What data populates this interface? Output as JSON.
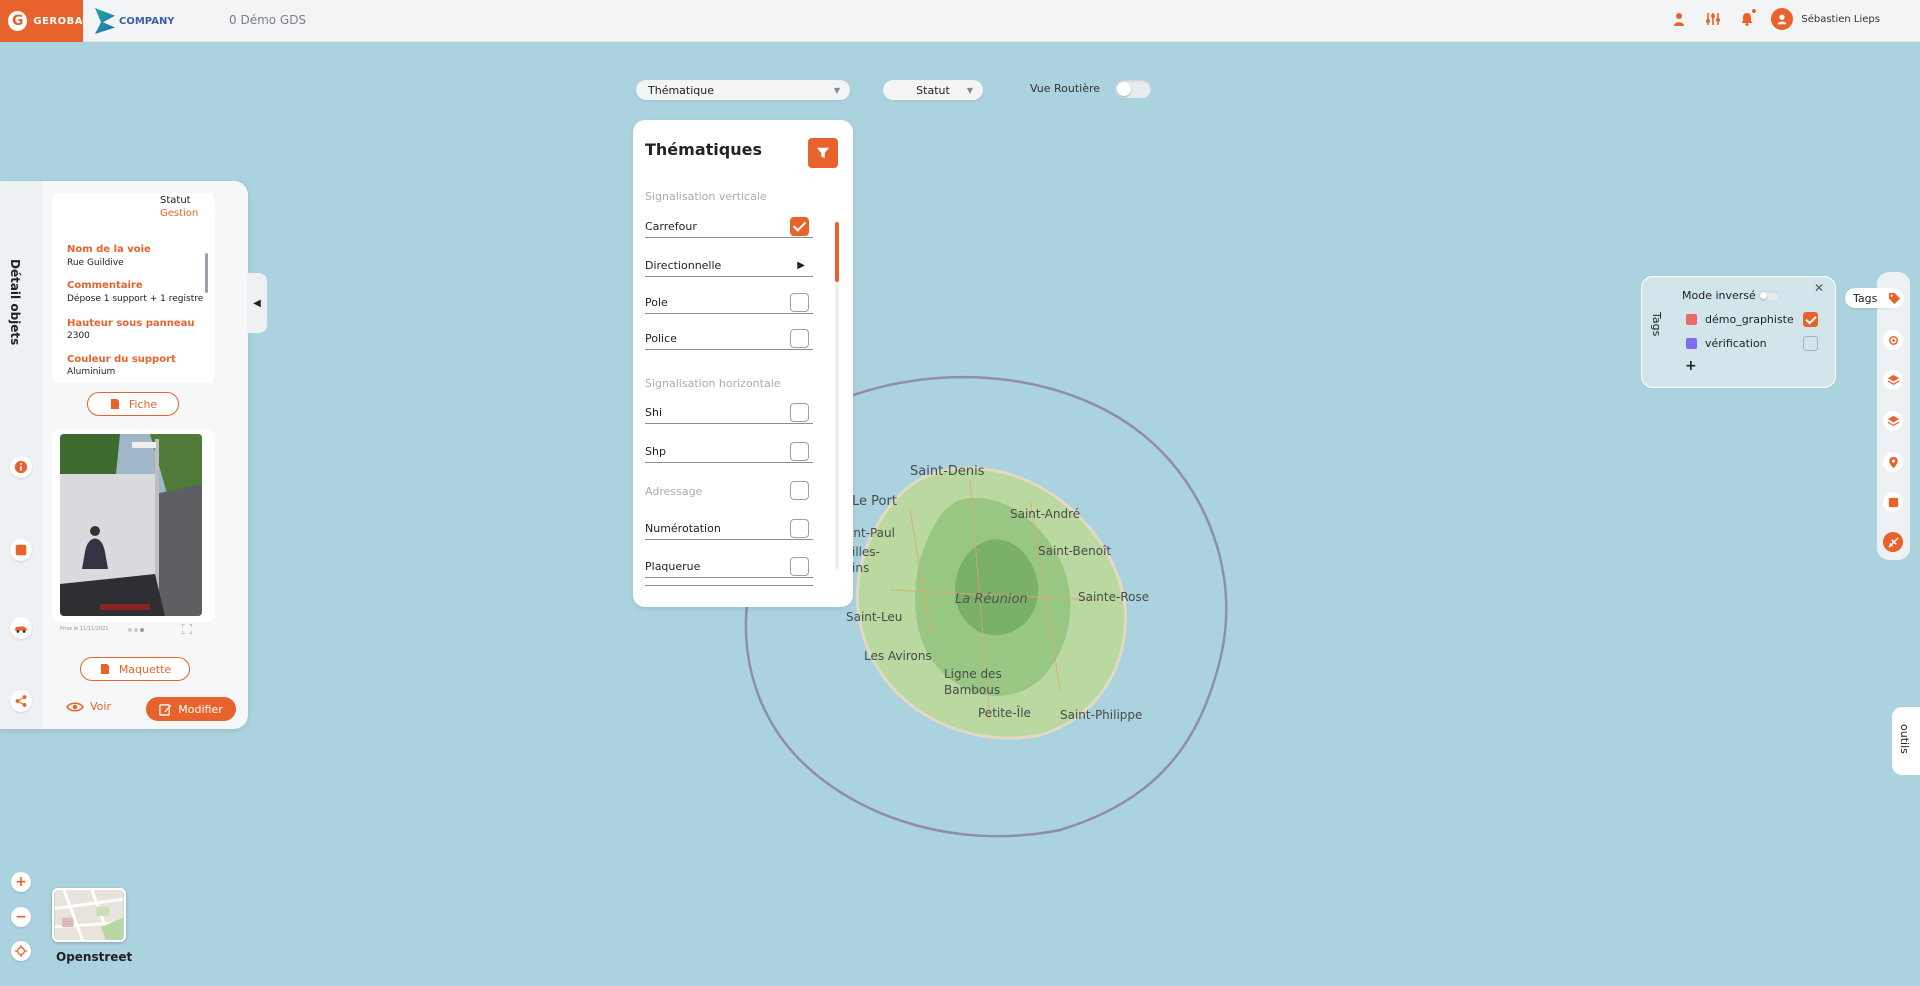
{
  "header": {
    "brand": "GEROBA",
    "company": "COMPANY",
    "project_title": "0 Démo GDS",
    "username": "Sébastien Lieps"
  },
  "controls": {
    "thematique_select": "Thématique",
    "statut_select": "Statut",
    "vue_routiere_label": "Vue Routière",
    "vue_routiere_on": false
  },
  "thematiques": {
    "title": "Thématiques",
    "sections": [
      {
        "label": "Signalisation verticale",
        "items": [
          {
            "label": "Carrefour",
            "checked": true
          },
          {
            "label": "Directionnelle",
            "expandable": true
          },
          {
            "label": "Pole",
            "checked": false
          },
          {
            "label": "Police",
            "checked": false
          }
        ]
      },
      {
        "label": "Signalisation horizontale",
        "items": [
          {
            "label": "Shi",
            "checked": false
          },
          {
            "label": "Shp",
            "checked": false
          }
        ]
      },
      {
        "label": "Adressage",
        "items": [
          {
            "label": "Numérotation",
            "checked": false
          },
          {
            "label": "Plaquerue",
            "checked": false
          }
        ]
      }
    ]
  },
  "detail": {
    "vertical_title": "Détail objets",
    "statut_label": "Statut",
    "statut_value": "Gestion",
    "attributes": [
      {
        "label": "Nom de la voie",
        "value": "Rue Guildive"
      },
      {
        "label": "Commentaire",
        "value": "Dépose 1 support + 1 registre"
      },
      {
        "label": "Hauteur sous panneau",
        "value": "2300"
      },
      {
        "label": "Couleur du support",
        "value": "Aluminium"
      }
    ],
    "fiche_button": "Fiche",
    "maquette_button": "Maquette",
    "voir_button": "Voir",
    "modifier_button": "Modifier",
    "photo_caption": "Prise le 11/11/2021"
  },
  "map": {
    "labels": [
      "Saint-Denis",
      "Le Port",
      "Saint-André",
      "int-Paul",
      "illes-",
      "ins",
      "Saint-Benoît",
      "La Réunion",
      "Sainte-Rose",
      "Saint-Leu",
      "Les Avirons",
      "Ligne des",
      "Bambous",
      "Petite-Île",
      "Saint-Philippe"
    ],
    "basemap_label": "Openstreet"
  },
  "tags_panel": {
    "vertical_title": "Tags",
    "mode_label": "Mode inversé",
    "mode_on": false,
    "tags": [
      {
        "name": "démo_graphiste",
        "color": "#e86a6a",
        "checked": true
      },
      {
        "name": "vérification",
        "color": "#7a6ff0",
        "checked": false
      }
    ],
    "add_symbol": "+"
  },
  "right_rail": {
    "tags_pill": "Tags",
    "outils_label": "outils"
  },
  "colors": {
    "accent": "#e8632b",
    "sea": "#aad3df"
  }
}
